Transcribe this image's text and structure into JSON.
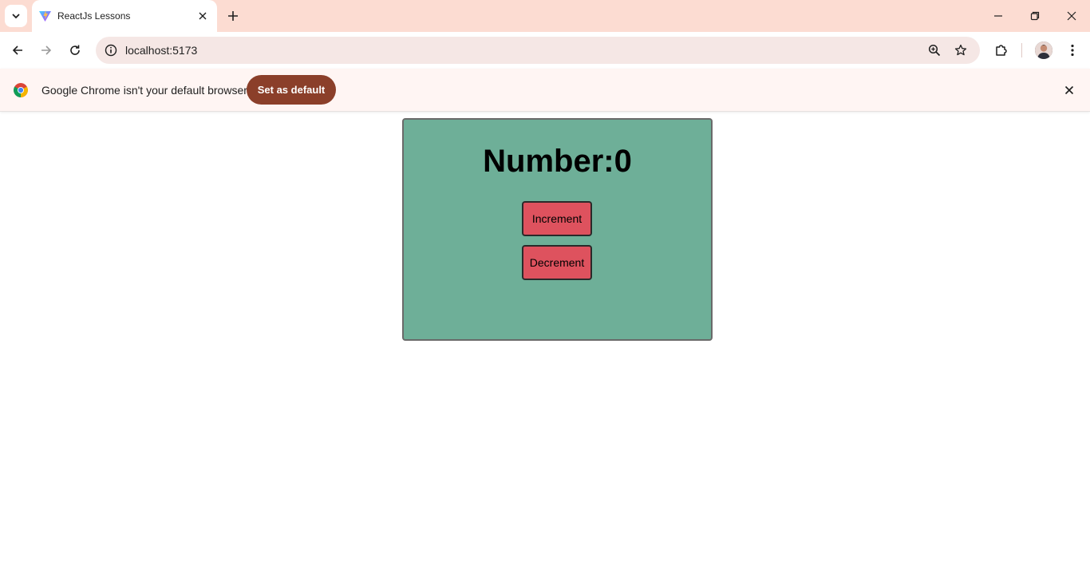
{
  "browser": {
    "tab": {
      "title": "ReactJs Lessons"
    },
    "address": {
      "url": "localhost:5173"
    },
    "infobar": {
      "message": "Google Chrome isn't your default browser",
      "button_label": "Set as default"
    }
  },
  "icons": [
    "tab-search-icon",
    "vite-favicon-icon",
    "close-icon",
    "plus-icon",
    "minimize-icon",
    "restore-icon",
    "back-icon",
    "forward-icon",
    "reload-icon",
    "info-icon",
    "zoom-icon",
    "star-icon",
    "extensions-icon",
    "more-icon",
    "chrome-logo-icon"
  ],
  "app": {
    "heading": "Number:0",
    "increment_label": "Increment",
    "decrement_label": "Decrement"
  },
  "colors": {
    "card_bg": "#6eaf98",
    "button_bg": "#de525e",
    "infobar_button_bg": "#8b3f2a",
    "tabstrip_bg": "#fcdcd2"
  }
}
